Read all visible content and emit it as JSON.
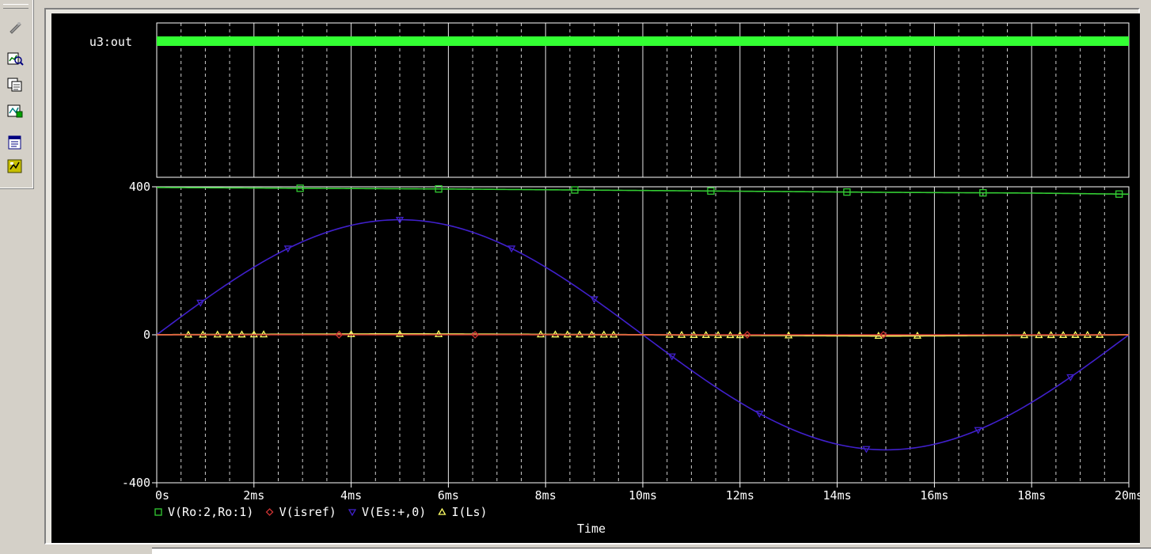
{
  "toolbar": {
    "items": [
      {
        "name": "probe-icon"
      },
      {
        "name": "zoom-fit-icon"
      },
      {
        "name": "copy-plot-icon"
      },
      {
        "name": "add-trace-icon"
      },
      {
        "name": "plot-list-icon"
      },
      {
        "name": "mark-data-icon"
      }
    ]
  },
  "colors": {
    "background": "#000000",
    "axis": "#ffffff",
    "grid": "#ffffff",
    "digital": "#33ff33",
    "v_ro": "#33cc33",
    "v_isref": "#cc3333",
    "v_es": "#4020cc",
    "i_ls": "#ffff66"
  },
  "chart_data": [
    {
      "type": "digital",
      "signal_label": "u3:out",
      "x": [
        0,
        20
      ],
      "values": [
        1,
        1
      ],
      "state": "high"
    },
    {
      "type": "line",
      "xlabel": "Time",
      "ylabel": "",
      "xunit": "ms",
      "xlim": [
        0,
        20
      ],
      "ylim": [
        -400,
        400
      ],
      "x_ticks": [
        0,
        2,
        4,
        6,
        8,
        10,
        12,
        14,
        16,
        18,
        20
      ],
      "x_tick_labels": [
        "0s",
        "2ms",
        "4ms",
        "6ms",
        "8ms",
        "10ms",
        "12ms",
        "14ms",
        "16ms",
        "18ms",
        "20ms"
      ],
      "y_ticks": [
        400,
        0,
        -400
      ],
      "y_tick_labels": [
        "400",
        "0",
        "-400"
      ],
      "grid": true,
      "legend_position": "bottom-left",
      "series": [
        {
          "name": "V(Ro:2,Ro:1)",
          "marker": "square",
          "color": "#33cc33",
          "x": [
            0,
            3,
            6,
            9,
            12,
            15,
            18,
            20
          ],
          "values": [
            398,
            396,
            394,
            391,
            388,
            385,
            383,
            380
          ],
          "marker_x": [
            2.95,
            5.8,
            8.6,
            11.4,
            14.2,
            17.0,
            19.8
          ]
        },
        {
          "name": "V(isref)",
          "marker": "diamond",
          "color": "#cc3333",
          "x": [
            0,
            20
          ],
          "values": [
            0,
            0
          ],
          "marker_x": [
            3.75,
            6.55,
            12.15,
            14.95
          ]
        },
        {
          "name": "V(Es:+,0)",
          "marker": "triangle-down",
          "color": "#4020cc",
          "function": "sine",
          "amplitude": 311,
          "frequency_hz": 50,
          "x": [
            0,
            2.5,
            5,
            7.5,
            10,
            12.5,
            15,
            17.5,
            20
          ],
          "values": [
            0,
            220,
            311,
            220,
            0,
            -220,
            -311,
            -220,
            0
          ],
          "marker_x": [
            0.9,
            2.7,
            5.0,
            7.3,
            9.0,
            10.6,
            12.4,
            14.6,
            16.9,
            18.8
          ]
        },
        {
          "name": "I(Ls)",
          "marker": "triangle-up",
          "color": "#ffff66",
          "x": [
            0,
            5,
            10,
            15,
            20
          ],
          "values": [
            0,
            2,
            0,
            -3,
            0
          ],
          "marker_x": [
            0.65,
            0.95,
            1.25,
            1.5,
            1.75,
            2.0,
            2.2,
            4.0,
            5.0,
            5.8,
            7.9,
            8.2,
            8.45,
            8.7,
            8.95,
            9.2,
            9.4,
            10.55,
            10.8,
            11.05,
            11.3,
            11.55,
            11.8,
            12.0,
            13.0,
            14.85,
            15.65,
            17.85,
            18.15,
            18.4,
            18.65,
            18.9,
            19.15,
            19.4
          ]
        }
      ]
    }
  ]
}
